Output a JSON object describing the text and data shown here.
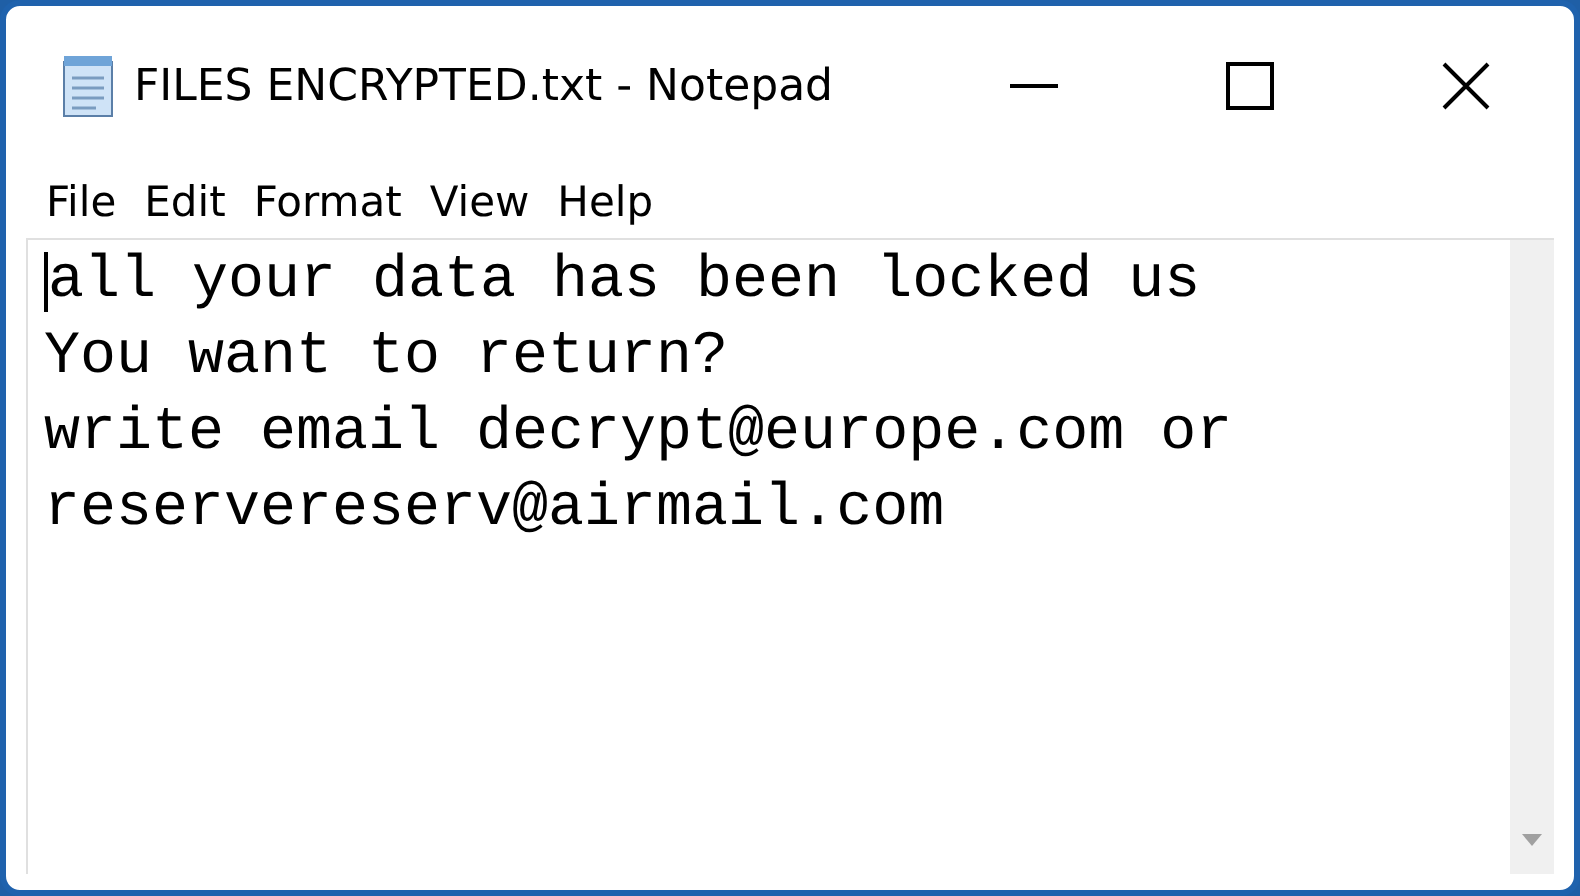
{
  "window": {
    "title": "FILES ENCRYPTED.txt - Notepad"
  },
  "menu": [
    {
      "label": "File"
    },
    {
      "label": "Edit"
    },
    {
      "label": "Format"
    },
    {
      "label": "View"
    },
    {
      "label": "Help"
    }
  ],
  "document": {
    "lines": [
      "all your data has been locked us",
      "You want to return?",
      "write email decrypt@europe.com or",
      "reservereserv@airmail.com"
    ]
  }
}
